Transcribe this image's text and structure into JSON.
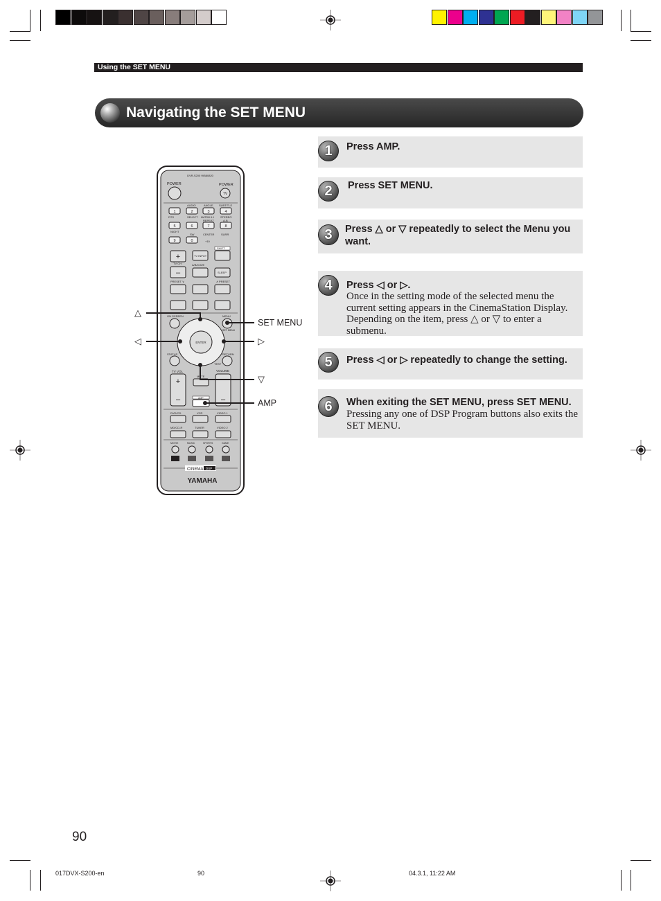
{
  "print_marks": {
    "gray_swatches": [
      "#000000",
      "#0d0b0b",
      "#161212",
      "#231f1f",
      "#3a3030",
      "#4f4545",
      "#6a5f5d",
      "#887d7b",
      "#a59d9b",
      "#d4cccb",
      "#ffffff"
    ],
    "color_swatches": [
      "#fff200",
      "#ec008c",
      "#00aeef",
      "#2e3192",
      "#00a651",
      "#ed1c24",
      "#231f20",
      "#fff57a",
      "#f282c5",
      "#7fd5f6",
      "#939598"
    ]
  },
  "header": {
    "section": "Using the SET MENU"
  },
  "title": "Navigating the SET MENU",
  "steps": [
    {
      "num": "1",
      "heading": "Press AMP.",
      "body": ""
    },
    {
      "num": "2",
      "heading": "Press SET MENU.",
      "body": ""
    },
    {
      "num": "3",
      "heading": "Press △ or ▽ repeatedly to select the Menu you want.",
      "body": ""
    },
    {
      "num": "4",
      "heading": "Press ◁ or ▷.",
      "body": "Once in the setting mode of the selected menu the current setting appears in the CinemaStation Display. Depending on the item, press △ or ▽ to enter a submenu."
    },
    {
      "num": "5",
      "heading": "Press ◁ or ▷ repeatedly to change the setting.",
      "body": ""
    },
    {
      "num": "6",
      "heading": "When exiting the SET MENU, press SET MENU.",
      "body": "Pressing any one of DSP Program buttons also exits the SET MENU."
    }
  ],
  "callouts": {
    "up": "△",
    "left": "◁",
    "right": "▷",
    "down": "▽",
    "set_menu": "SET MENU",
    "amp": "AMP"
  },
  "remote": {
    "model": "DVR-S200 WB80820",
    "power_left": "POWER",
    "power_right": "POWER",
    "tv": "TV",
    "audio": "AUDIO",
    "angle": "ANGLE",
    "subtitle": "SUBTITLE",
    "dts": "DTS",
    "select": "SELECT",
    "matrix": "MATRIX 6.1",
    "stereo": "STEREO",
    "repeat": "REPEAT",
    "ab": "A-B",
    "night": "NIGHT",
    "sw": "SW",
    "center": "CENTER",
    "surr": "SURR",
    "plus10": "+10",
    "shift": "SHIFT",
    "digits": [
      "1",
      "2",
      "3",
      "4",
      "5",
      "6",
      "7",
      "8",
      "9",
      "0"
    ],
    "tv_input": "TV INPUT",
    "tv_ch": "TV CH",
    "abcde": "A/B/C/D/E",
    "sleep": "SLEEP",
    "preset_down": "PRESET ∨",
    "preset_up": "∧ PRESET",
    "on_screen": "ON SCREEN",
    "menu": "MENU",
    "set_menu": "SET MENU",
    "enter": "ENTER",
    "status": "STATUS",
    "return": "RETURN",
    "test": "TEST",
    "tv_vol": "TV VOL",
    "mute": "MUTE",
    "volume": "VOLUME",
    "amp": "AMP",
    "dvd_cd": "DVD/CD",
    "vcr": "VCR",
    "video1": "VIDEO 1",
    "md_cdr": "MD/CD-R",
    "tuner": "TUNER",
    "video2": "VIDEO 2",
    "movie": "MOVIE",
    "music": "MUSIC",
    "sports": "SPORTS",
    "game": "GAME",
    "cinema": "CINEMA",
    "dsp": "DSP",
    "brand": "YAMAHA"
  },
  "page_number": "90",
  "footer": {
    "file": "017DVX-S200-en",
    "page": "90",
    "timestamp": "04.3.1, 11:22 AM"
  }
}
